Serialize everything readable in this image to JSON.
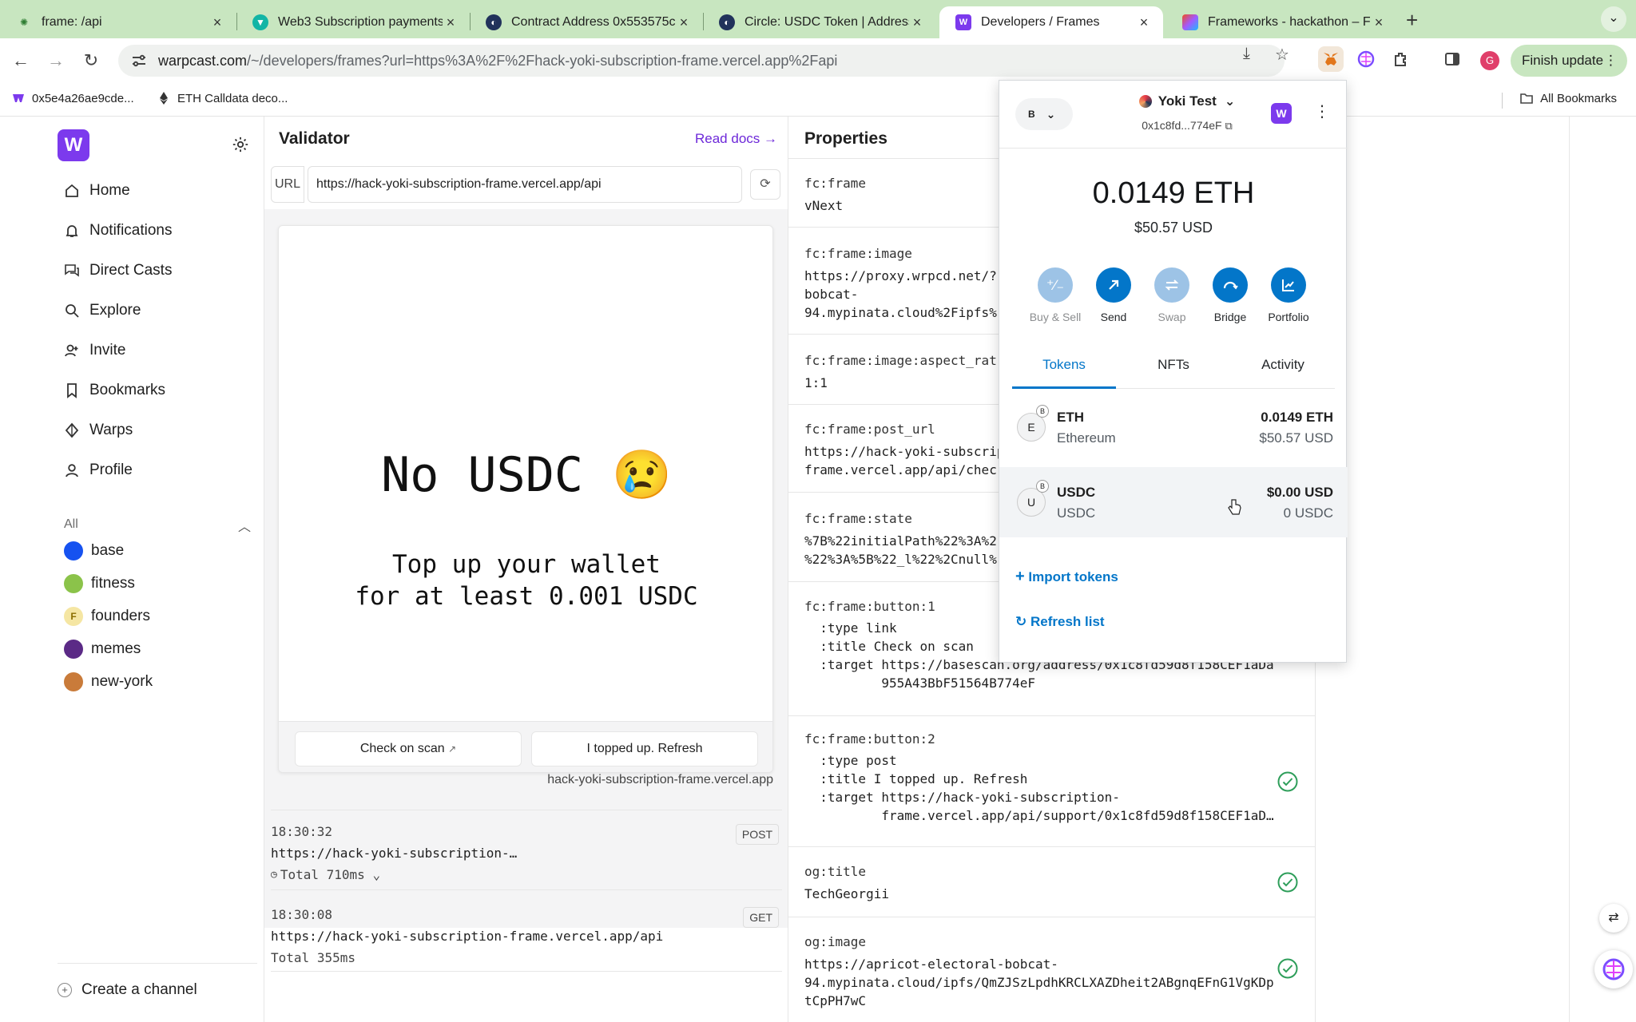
{
  "browser": {
    "tabs": [
      {
        "title": "frame: /api"
      },
      {
        "title": "Web3 Subscription payments"
      },
      {
        "title": "Contract Address 0x553575c"
      },
      {
        "title": "Circle: USDC Token | Address"
      },
      {
        "title": "Developers / Frames"
      },
      {
        "title": "Frameworks - hackathon – Fi"
      }
    ],
    "url_host": "warpcast.com",
    "url_path": "/~/developers/frames?url=https%3A%2F%2Fhack-yoki-subscription-frame.vercel.app%2Fapi",
    "finish_update_label": "Finish update",
    "profile_initial": "G",
    "bookmarks": [
      {
        "label": "0x5e4a26ae9cde..."
      },
      {
        "label": "ETH Calldata deco..."
      }
    ],
    "all_bookmarks_label": "All Bookmarks"
  },
  "sidebar": {
    "logo": "W",
    "nav": [
      {
        "label": "Home",
        "icon": "home-icon"
      },
      {
        "label": "Notifications",
        "icon": "bell-icon"
      },
      {
        "label": "Direct Casts",
        "icon": "chat-icon"
      },
      {
        "label": "Explore",
        "icon": "search-icon"
      },
      {
        "label": "Invite",
        "icon": "invite-icon"
      },
      {
        "label": "Bookmarks",
        "icon": "bookmark-icon"
      },
      {
        "label": "Warps",
        "icon": "diamond-icon"
      },
      {
        "label": "Profile",
        "icon": "person-icon"
      }
    ],
    "channels_header": "All",
    "channels": [
      {
        "name": "base",
        "color": "#1652f0"
      },
      {
        "name": "fitness",
        "color": "#8bc34a"
      },
      {
        "name": "founders",
        "color": "#f5e6a3"
      },
      {
        "name": "memes",
        "color": "#5b2a86"
      },
      {
        "name": "new-york",
        "color": "#c97b3a"
      }
    ],
    "create_channel_label": "Create a channel"
  },
  "validator": {
    "title": "Validator",
    "read_docs": "Read docs",
    "url_label": "URL",
    "url_value": "https://hack-yoki-subscription-frame.vercel.app/api",
    "frame": {
      "headline": "No USDC",
      "emoji": "😢",
      "subtext": "Top up your wallet\nfor at least 0.001 USDC",
      "buttons": [
        {
          "label": "Check on scan",
          "link": true
        },
        {
          "label": "I topped up. Refresh",
          "link": false
        }
      ],
      "host": "hack-yoki-subscription-frame.vercel.app"
    },
    "requests": [
      {
        "time": "18:30:32",
        "url": "https://hack-yoki-subscription-…",
        "total_label": "Total",
        "total": "710ms",
        "method": "POST"
      },
      {
        "time": "18:30:08",
        "url": "https://hack-yoki-subscription-frame.vercel.app/api",
        "total_label": "Total",
        "total": "355ms",
        "method": "GET"
      }
    ]
  },
  "properties": {
    "title": "Properties",
    "items": [
      {
        "key": "fc:frame",
        "value": "vNext"
      },
      {
        "key": "fc:frame:image",
        "value": "https://proxy.wrpcd.net/?\nbobcat-\n94.mypinata.cloud%2Fipfs%"
      },
      {
        "key": "fc:frame:image:aspect_rat",
        "value": "1:1"
      },
      {
        "key": "fc:frame:post_url",
        "value": "https://hack-yoki-subscrip\nframe.vercel.app/api/chec"
      },
      {
        "key": "fc:frame:state",
        "value": "%7B%22initialPath%22%3A%2\n%22%3A%5B%22_l%22%2Cnull%"
      },
      {
        "key": "fc:frame:button:1",
        "value": "  :type link\n  :title Check on scan\n  :target https://basescan.org/address/0x1c8fd59d8f158CEF1aDa\n          955A43BbF51564B774eF"
      },
      {
        "key": "fc:frame:button:2",
        "value": "  :type post\n  :title I topped up. Refresh\n  :target https://hack-yoki-subscription-\n          frame.vercel.app/api/support/0x1c8fd59d8f158CEF1aD…"
      },
      {
        "key": "og:title",
        "value": "TechGeorgii"
      },
      {
        "key": "og:image",
        "value": "https://apricot-electoral-bobcat-\n94.mypinata.cloud/ipfs/QmZJSzLpdhKRCLXAZDheit2ABgnqEFnG1VgKDp\ntCpPH7wC"
      }
    ]
  },
  "wallet": {
    "network_badge": "B",
    "account_name": "Yoki Test",
    "address": "0x1c8fd...774eF",
    "balance": "0.0149 ETH",
    "balance_usd": "$50.57 USD",
    "actions": [
      {
        "label": "Buy & Sell",
        "disabled": true
      },
      {
        "label": "Send",
        "disabled": false
      },
      {
        "label": "Swap",
        "disabled": true
      },
      {
        "label": "Bridge",
        "disabled": false
      },
      {
        "label": "Portfolio",
        "disabled": false
      }
    ],
    "tabs": [
      "Tokens",
      "NFTs",
      "Activity"
    ],
    "active_tab": "Tokens",
    "tokens": [
      {
        "icon": "E",
        "badge": "B",
        "symbol": "ETH",
        "name": "Ethereum",
        "amount": "0.0149 ETH",
        "fiat": "$50.57 USD"
      },
      {
        "icon": "U",
        "badge": "B",
        "symbol": "USDC",
        "name": "USDC",
        "amount": "$0.00 USD",
        "fiat": "0 USDC"
      }
    ],
    "import_tokens": "Import tokens",
    "refresh_list": "Refresh list",
    "accent": "#0376c9"
  }
}
